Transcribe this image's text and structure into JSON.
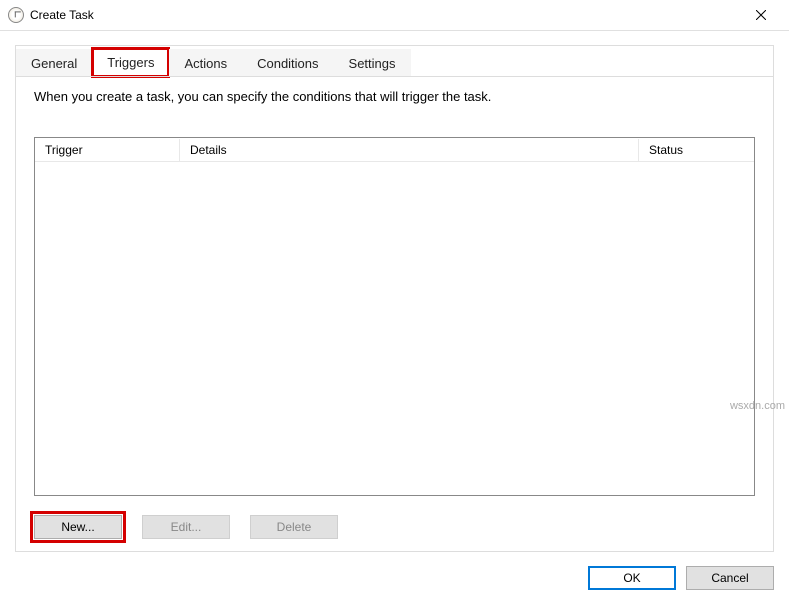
{
  "window": {
    "title": "Create Task"
  },
  "tabs": {
    "general": "General",
    "triggers": "Triggers",
    "actions": "Actions",
    "conditions": "Conditions",
    "settings": "Settings"
  },
  "panel": {
    "instruction": "When you create a task, you can specify the conditions that will trigger the task."
  },
  "table": {
    "columns": {
      "trigger": "Trigger",
      "details": "Details",
      "status": "Status"
    },
    "rows": []
  },
  "actions": {
    "new": "New...",
    "edit": "Edit...",
    "delete": "Delete"
  },
  "dialog": {
    "ok": "OK",
    "cancel": "Cancel"
  },
  "watermark": "wsxdn.com"
}
